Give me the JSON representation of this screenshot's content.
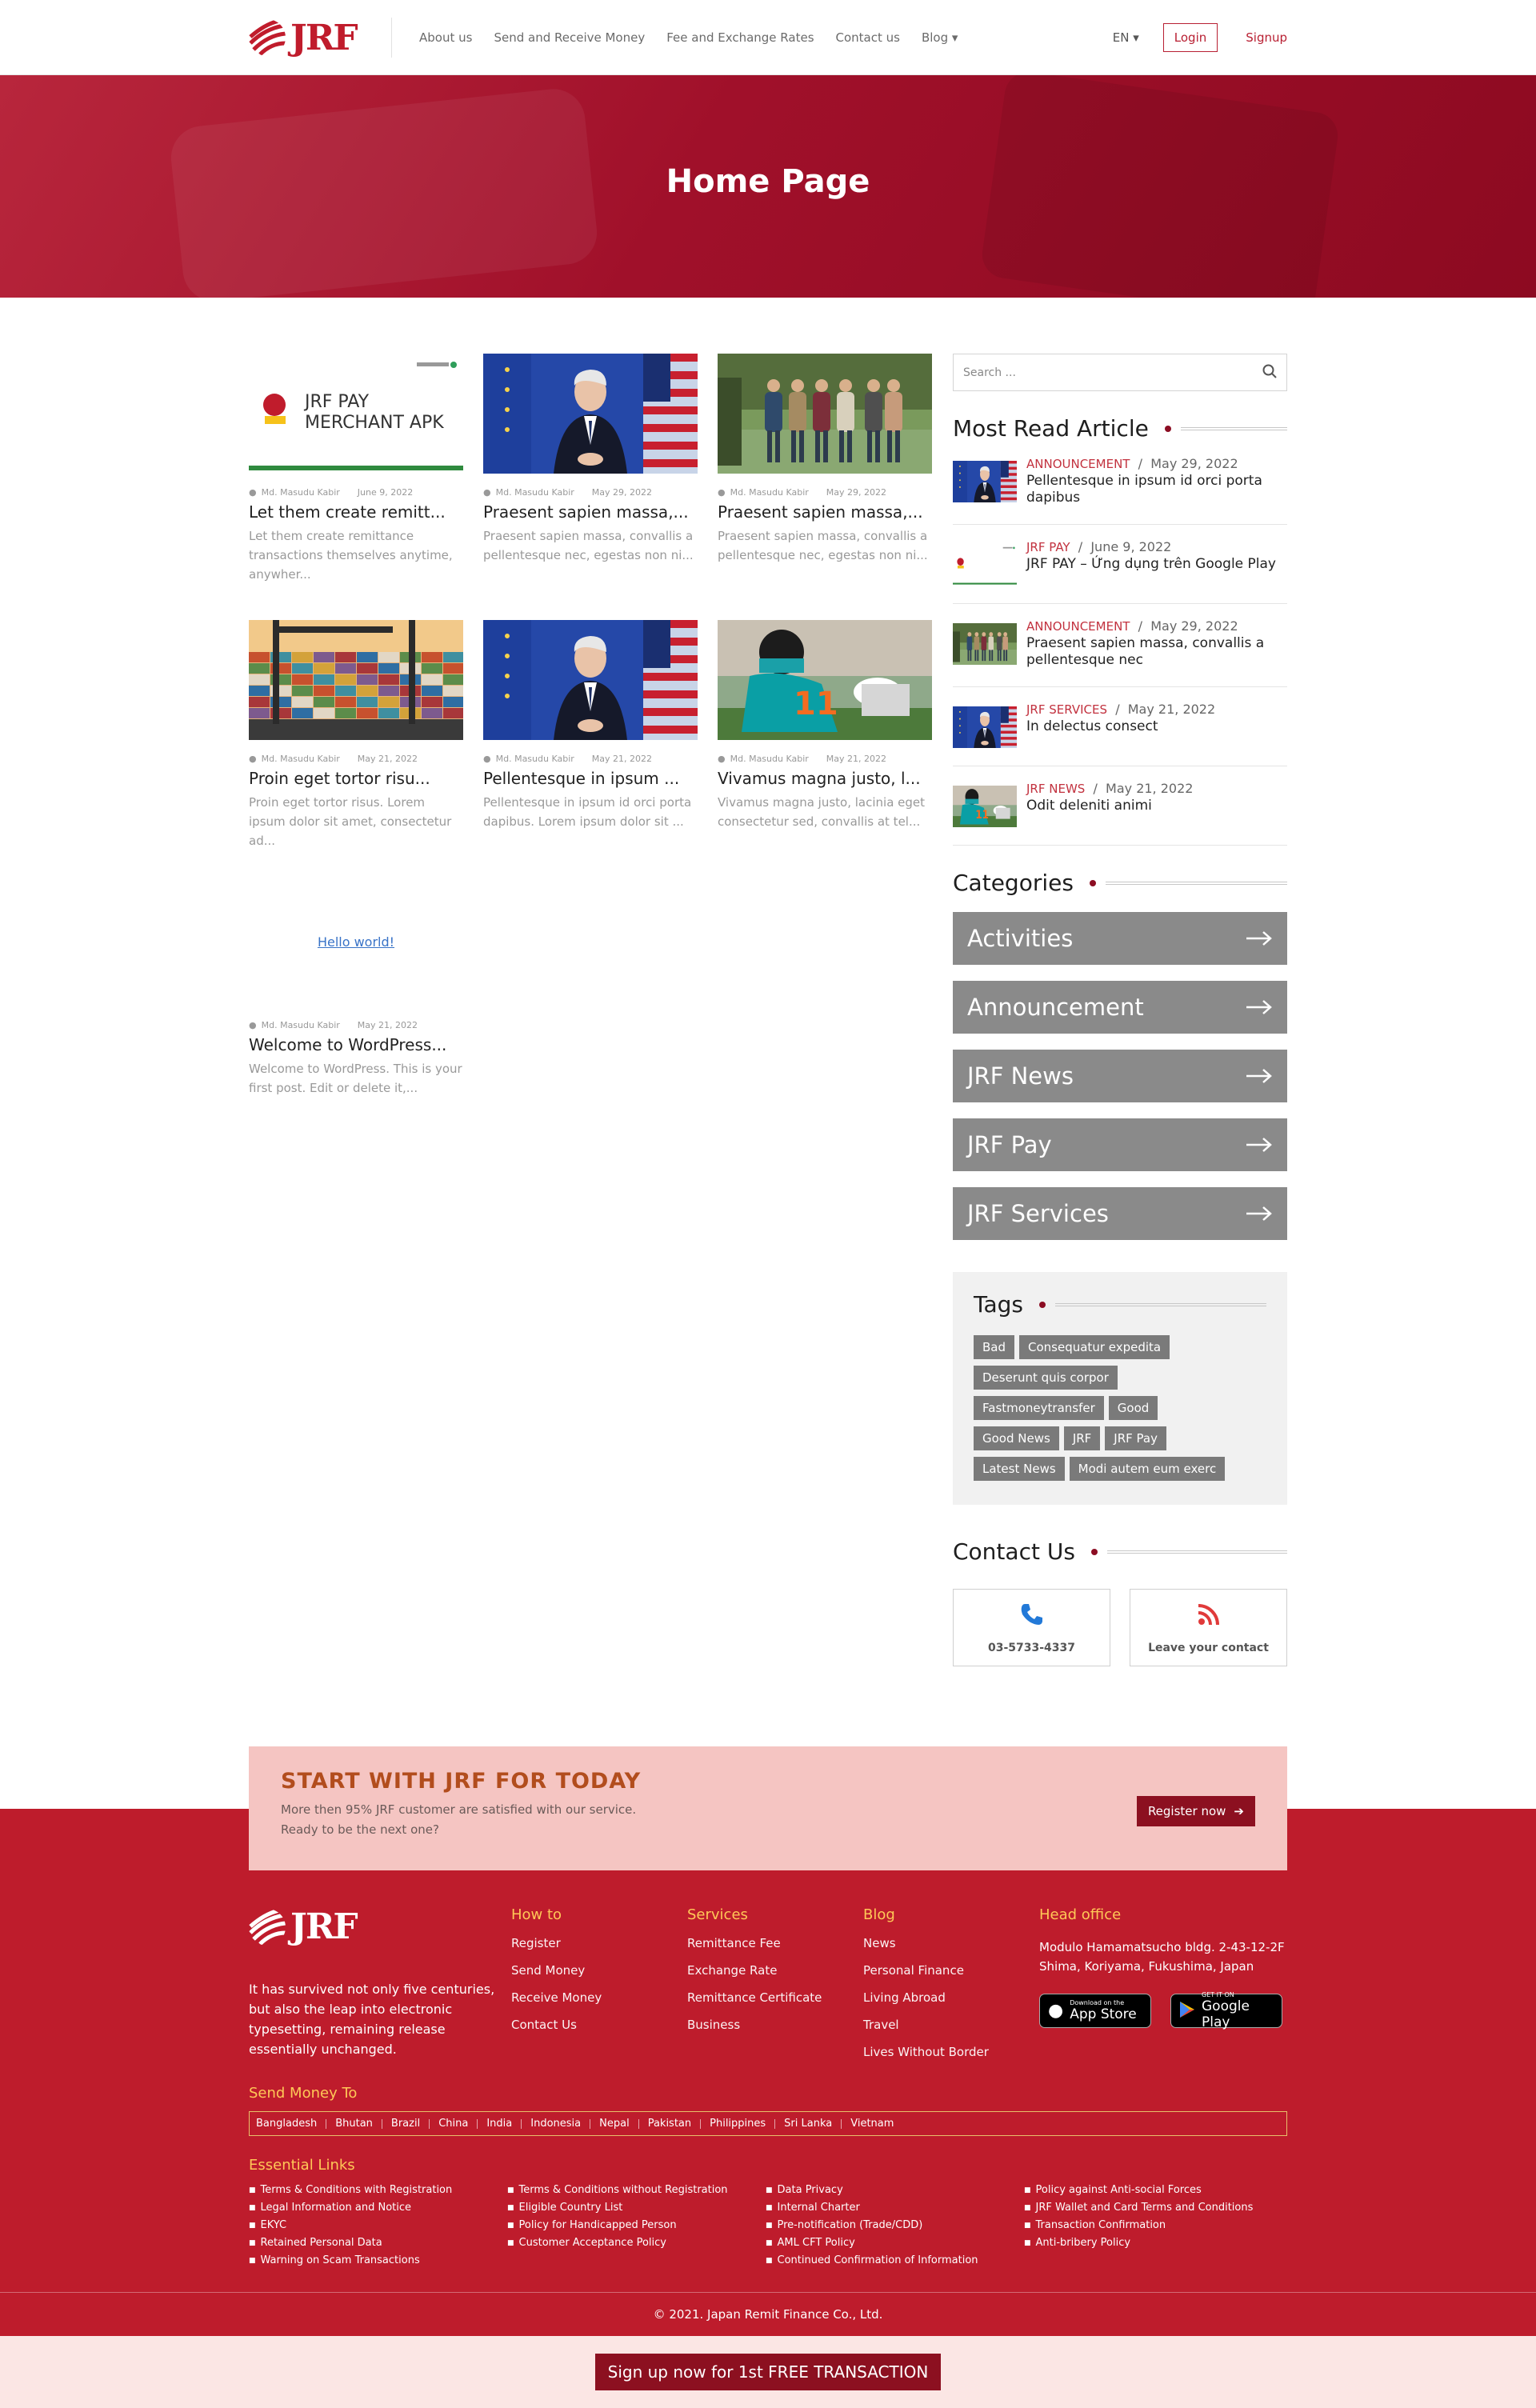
{
  "header": {
    "logo_text": "JRF",
    "nav": [
      "About us",
      "Send and Receive Money",
      "Fee and Exchange Rates",
      "Contact us",
      "Blog ▾"
    ],
    "language": "EN ▾",
    "login": "Login",
    "signup": "Signup"
  },
  "banner": {
    "title": "Home Page"
  },
  "posts": [
    {
      "author": "Md. Masudu Kabir",
      "date": "June 9, 2022",
      "title": "Let them create remitt...",
      "excerpt": "Let them create remittance transactions themselves anytime, anywher...",
      "thumb": "merchant",
      "thumb_text": "JRF PAY\nMERCHANT APK"
    },
    {
      "author": "Md. Masudu Kabir",
      "date": "May 29, 2022",
      "title": "Praesent sapien massa,...",
      "excerpt": "Praesent sapien massa, convallis a pellentesque nec, egestas non ni...",
      "thumb": "flags"
    },
    {
      "author": "Md. Masudu Kabir",
      "date": "May 29, 2022",
      "title": "Praesent sapien massa,...",
      "excerpt": "Praesent sapien massa, convallis a pellentesque nec, egestas non ni...",
      "thumb": "park"
    },
    {
      "author": "Md. Masudu Kabir",
      "date": "May 21, 2022",
      "title": "Proin eget tortor risu...",
      "excerpt": "Proin eget tortor risus. Lorem ipsum dolor sit amet, consectetur ad...",
      "thumb": "port"
    },
    {
      "author": "Md. Masudu Kabir",
      "date": "May 21, 2022",
      "title": "Pellentesque in ipsum ...",
      "excerpt": "Pellentesque in ipsum id orci porta dapibus. Lorem ipsum dolor sit ...",
      "thumb": "flags"
    },
    {
      "author": "Md. Masudu Kabir",
      "date": "May 21, 2022",
      "title": "Vivamus magna justo, l...",
      "excerpt": "Vivamus magna justo, lacinia eget consectetur sed, convallis at tel...",
      "thumb": "football"
    },
    {
      "author": "Md. Masudu Kabir",
      "date": "May 21, 2022",
      "title": "Welcome to WordPress...",
      "excerpt": "Welcome to WordPress. This is your first post. Edit or delete it,...",
      "thumb": "broken",
      "thumb_alt": "Hello world!"
    }
  ],
  "sidebar": {
    "search_placeholder": "Search ...",
    "most_read_heading": "Most Read Article",
    "most_read": [
      {
        "category": "ANNOUNCEMENT",
        "date": "May 29, 2022",
        "title": "Pellentesque in ipsum id orci porta dapibus",
        "thumb": "flags"
      },
      {
        "category": "JRF PAY",
        "date": "June 9, 2022",
        "title": "JRF PAY – Ứng dụng trên Google Play",
        "thumb": "merchant"
      },
      {
        "category": "ANNOUNCEMENT",
        "date": "May 29, 2022",
        "title": "Praesent sapien massa, convallis a pellentesque nec",
        "thumb": "park"
      },
      {
        "category": "JRF SERVICES",
        "date": "May 21, 2022",
        "title": "In delectus consect",
        "thumb": "flags"
      },
      {
        "category": "JRF NEWS",
        "date": "May 21, 2022",
        "title": "Odit deleniti animi",
        "thumb": "football"
      }
    ],
    "categories_heading": "Categories",
    "categories": [
      "Activities",
      "Announcement",
      "JRF News",
      "JRF Pay",
      "JRF Services"
    ],
    "tags_heading": "Tags",
    "tags": [
      "Bad",
      "Consequatur expedita",
      "Deserunt quis corpor",
      "Fastmoneytransfer",
      "Good",
      "Good News",
      "JRF",
      "JRF Pay",
      "Latest News",
      "Modi autem eum exerc"
    ],
    "contact_heading": "Contact Us",
    "phone": "03-5733-4337",
    "leave_contact": "Leave your contact"
  },
  "cta": {
    "title": "START WITH JRF FOR TODAY",
    "line1": "More then 95% JRF customer are satisfied with our service.",
    "line2": "Ready to be the next one?",
    "button": "Register now"
  },
  "footer": {
    "about": "It has survived not only five centuries, but also the leap into electronic typesetting, remaining release essentially unchanged.",
    "columns": [
      {
        "heading": "How to",
        "links": [
          "Register",
          "Send Money",
          "Receive Money",
          "Contact Us"
        ]
      },
      {
        "heading": "Services",
        "links": [
          "Remittance Fee",
          "Exchange Rate",
          "Remittance Certificate",
          "Business"
        ]
      },
      {
        "heading": "Blog",
        "links": [
          "News",
          "Personal Finance",
          "Living Abroad",
          "Travel",
          "Lives Without Border"
        ]
      }
    ],
    "head_office_heading": "Head office",
    "head_office_address": "Modulo Hamamatsucho bldg. 2-43-12-2F Shima, Koriyama, Fukushima, Japan",
    "app_store_small": "Download on the",
    "app_store": "App Store",
    "google_play_small": "GET IT ON",
    "google_play": "Google Play",
    "send_money_heading": "Send Money To",
    "countries": [
      "Bangladesh",
      "Bhutan",
      "Brazil",
      "China",
      "India",
      "Indonesia",
      "Nepal",
      "Pakistan",
      "Philippines",
      "Sri Lanka",
      "Vietnam"
    ],
    "essential_heading": "Essential Links",
    "essential": [
      [
        "Terms & Conditions with Registration",
        "Legal Information and Notice",
        "EKYC",
        "Retained Personal Data",
        "Warning on Scam Transactions"
      ],
      [
        "Terms & Conditions without Registration",
        "Eligible Country List",
        "Policy for Handicapped Person",
        "Customer Acceptance Policy"
      ],
      [
        "Data Privacy",
        "Internal Charter",
        "Pre-notification (Trade/CDD)",
        "AML CFT Policy",
        "Continued Confirmation of Information"
      ],
      [
        "Policy against Anti-social Forces",
        "JRF Wallet and Card Terms and Conditions",
        "Transaction Confirmation",
        "Anti-bribery Policy"
      ]
    ],
    "copyright": "© 2021. Japan Remit Finance Co., Ltd.",
    "free_transaction": "Sign up now for 1st FREE TRANSACTION"
  },
  "colors": {
    "brand": "#be1c2c",
    "dark_brand": "#8c1020",
    "accent_yellow": "#ffc857",
    "category_grey": "#8a8a8a"
  }
}
